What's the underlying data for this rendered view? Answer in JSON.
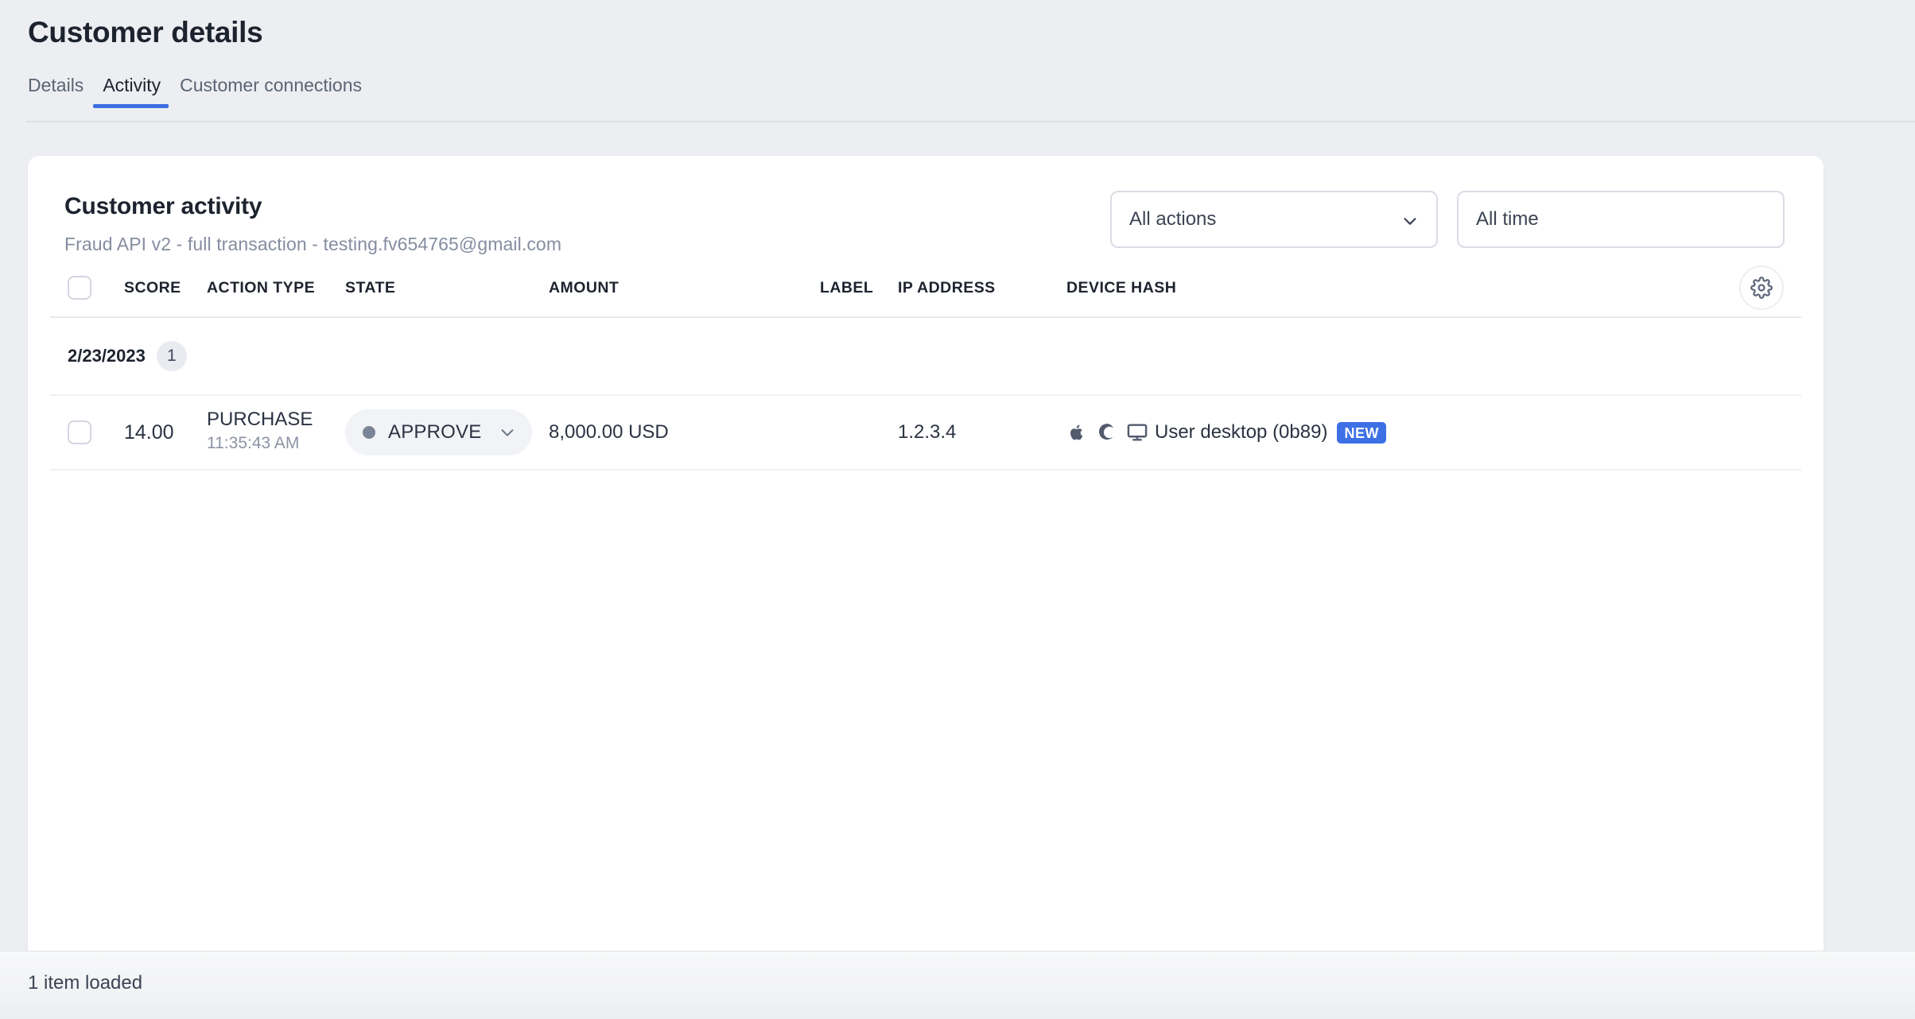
{
  "header": {
    "title": "Customer details",
    "tabs": [
      {
        "label": "Details",
        "active": false
      },
      {
        "label": "Activity",
        "active": true
      },
      {
        "label": "Customer connections",
        "active": false
      }
    ]
  },
  "card": {
    "title": "Customer activity",
    "subtitle": "Fraud API v2 - full transaction - testing.fv654765@gmail.com"
  },
  "filters": {
    "action_filter": {
      "value": "All actions",
      "icon": "chevron-down-icon"
    },
    "time_filter": {
      "value": "All time"
    }
  },
  "table": {
    "settings_icon": "gear-icon",
    "columns": [
      {
        "key": "score",
        "label": "SCORE"
      },
      {
        "key": "action_type",
        "label": "ACTION TYPE"
      },
      {
        "key": "state",
        "label": "STATE"
      },
      {
        "key": "amount",
        "label": "AMOUNT"
      },
      {
        "key": "label",
        "label": "LABEL"
      },
      {
        "key": "ip_address",
        "label": "IP ADDRESS"
      },
      {
        "key": "device_hash",
        "label": "DEVICE HASH"
      }
    ],
    "group": {
      "date": "2/23/2023",
      "count": "1"
    },
    "rows": [
      {
        "score": "14.00",
        "action_type": "PURCHASE",
        "action_time": "11:35:43 AM",
        "state": "APPROVE",
        "state_dot_color": "#7b8396",
        "amount": "8,000.00 USD",
        "label": "",
        "ip_address": "1.2.3.4",
        "device_icons": [
          "apple-icon",
          "browser-icon",
          "desktop-monitor-icon"
        ],
        "device_text": "User desktop (0b89)",
        "device_badge": "NEW"
      }
    ]
  },
  "footer": {
    "status": "1 item loaded"
  },
  "colors": {
    "accent": "#3c6ee0",
    "badge": "#3d6fe5",
    "page_bg": "#eceef1",
    "card_bg": "#ffffff",
    "muted_text": "#858da0"
  }
}
